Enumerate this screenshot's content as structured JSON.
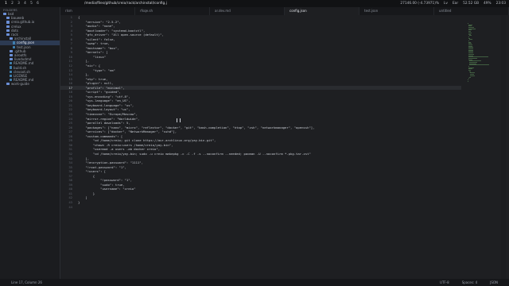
{
  "topbar": {
    "workspaces": [
      "1",
      "2",
      "3",
      "4",
      "5",
      "6"
    ],
    "active_workspace": 0,
    "path": "/media/files/github/creio/rack/archinstall/config.j",
    "stats": [
      "27146.00 (-4.73971)%",
      "Lv",
      "Ear",
      "52.52 GB",
      "49%",
      "23:03"
    ]
  },
  "sidebar": {
    "header": "FOLDERS",
    "items": [
      {
        "label": "bsd",
        "kind": "folder",
        "depth": 0
      },
      {
        "label": "bauweb",
        "kind": "folder",
        "depth": 1
      },
      {
        "label": "creio.github.io",
        "kind": "folder",
        "depth": 1
      },
      {
        "label": "crelux",
        "kind": "folder",
        "depth": 1
      },
      {
        "label": "dots",
        "kind": "folder",
        "depth": 1
      },
      {
        "label": "rack",
        "kind": "folder",
        "depth": 1
      },
      {
        "label": "archinstall",
        "kind": "folder",
        "depth": 2
      },
      {
        "label": "config.json",
        "kind": "file",
        "depth": 3,
        "selected": true
      },
      {
        "label": "test.json",
        "kind": "file",
        "depth": 3
      },
      {
        "label": ".github",
        "kind": "folder",
        "depth": 2
      },
      {
        "label": "airootfs",
        "kind": "folder",
        "depth": 2
      },
      {
        "label": "livedvdmd",
        "kind": "folder",
        "depth": 2
      },
      {
        "label": "README.md",
        "kind": "file",
        "depth": 2
      },
      {
        "label": "build.sh",
        "kind": "file",
        "depth": 2
      },
      {
        "label": "clevoot.sh",
        "kind": "file",
        "depth": 2
      },
      {
        "label": "LICENSE",
        "kind": "file",
        "depth": 2
      },
      {
        "label": "README.md",
        "kind": "file",
        "depth": 2
      },
      {
        "label": "work-guide",
        "kind": "folder",
        "depth": 1
      }
    ]
  },
  "tabs": [
    {
      "label": "rlsm"
    },
    {
      "label": "rfsqe.sh"
    },
    {
      "label": "ar.dev.md"
    },
    {
      "label": "config.json",
      "active": true
    },
    {
      "label": "test.json"
    },
    {
      "label": "untitled"
    }
  ],
  "editor": {
    "current_line": 17,
    "lines": [
      "{",
      "    \"version\": \"2.5.2\",",
      "    \"audio\": \"none\",",
      "    \"bootloader\": \"systemd-bootctl\",",
      "    \"gfx_driver\": \"All open-source (default)\",",
      "    \"silent\": false,",
      "    \"swap\": true,",
      "    \"hostname\": \"box\",",
      "    \"kernels\": [",
      "        \"linux\"",
      "    ],",
      "    \"nic\": {",
      "        \"type\": \"nm\"",
      "    },",
      "    \"ntp\": true,",
      "    \"plugin\": null,",
      "    \"profile\": \"minimal\",",
      "    \"script\": \"guided\",",
      "    \"sys-encoding\": \"utf-8\",",
      "    \"sys-language\": \"en_US\",",
      "    \"keyboard-language\": \"us\",",
      "    \"keyboard-layout\": \"us\",",
      "    \"timezone\": \"Europe/Moscow\",",
      "    \"mirror-region\": \"Worldwide\",",
      "    \"parallel downloads\": 5,",
      "    \"packages\": [\"nano\", \"micro\", \"reflector\", \"docker\", \"git\", \"bash-completion\", \"htop\", \"zsh\", \"networkmanager\", \"openssh\"],",
      "    \"services\": [\"docker\", \"NetworkManager\", \"sshd\"],",
      "    \"custom-commands\": [",
      "        \"cd /home/creio; git clone https://aur.archlinux.org/yay-bin.git\",",
      "        \"chown -R creio:users /home/creio/yay-bin\",",
      "        \"usermod -a users -ab docker creio\",",
      "        \"cd /home/creio/yay-bin; sudo -u creio makepkg -c -C -f -s --noconfirm --needed; pacman -U --noconfirm *.pkg.tar.zst\"",
      "    ],",
      "    \"!encryption-password\": \"1111\",",
      "    \"!root-password\": \"1\",",
      "    \"!users\": [",
      "        {",
      "            \"!password\": \"1\",",
      "            \"sudo\": true,",
      "            \"username\": \"creio\"",
      "        }",
      "    ]",
      "}",
      ""
    ]
  },
  "statusbar": {
    "position": "Line 17, Column 26",
    "encoding": "UTF-8",
    "indent": "Spaces: 4",
    "syntax": "JSON"
  },
  "colors": {
    "background": "#1e1f22",
    "sidebar": "#1b1c1f",
    "selection": "#2c3a52",
    "text": "#c9cdd4"
  }
}
